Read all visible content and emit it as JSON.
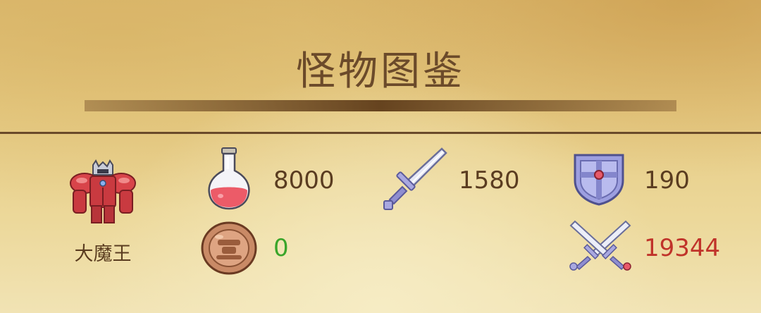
{
  "header": {
    "title": "怪物图鉴"
  },
  "monster": {
    "name": "大魔王",
    "icon": "red-armored-demon-king-icon",
    "stats": {
      "hp": "8000",
      "attack": "1580",
      "defense": "190",
      "gold": "0",
      "damage": "19344"
    }
  },
  "colors": {
    "text": "#5a3c20",
    "gold": "#3aa52a",
    "damage": "#c0332a",
    "divider": "#6a4a2a"
  },
  "icons": {
    "hp": "red-potion-icon",
    "attack": "sword-icon",
    "defense": "shield-icon",
    "gold": "coin-icon",
    "damage": "crossed-swords-icon"
  }
}
